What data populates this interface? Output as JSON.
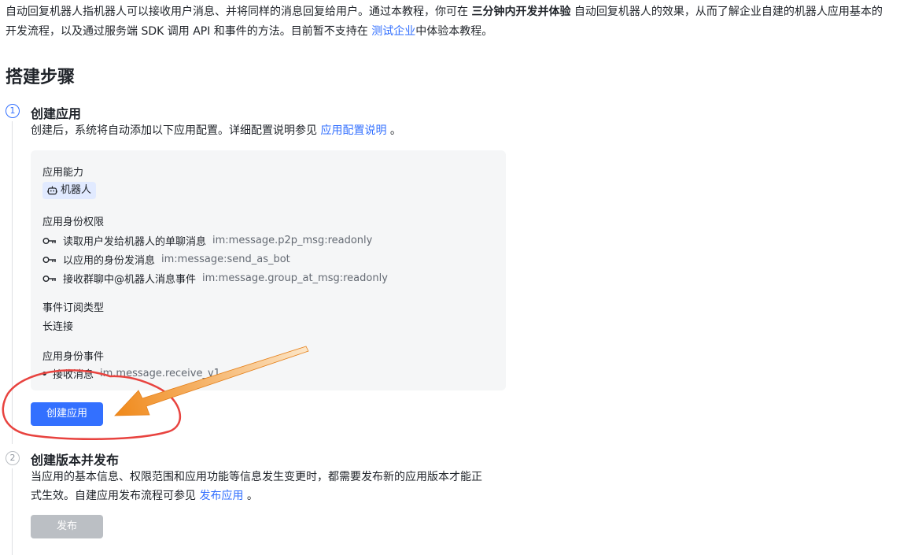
{
  "intro": {
    "text_1": "自动回复机器人指机器人可以接收用户消息、并将同样的消息回复给用户。通过本教程，你可在",
    "bold": "三分钟内开发并体验",
    "text_2": "自动回复机器人的效果，从而了解企业自建的机器人应用基本的开发流程，以及通过服务端 SDK 调用 API 和事件的方法。目前暂不支持在",
    "link": "测试企业",
    "text_3": "中体验本教程。"
  },
  "section_title": "搭建步骤",
  "steps": [
    {
      "num": "1",
      "title": "创建应用",
      "desc": "创建后，系统将自动添加以下应用配置。详细配置说明参见",
      "desc_link": "应用配置说明",
      "desc_tail": "。",
      "config": {
        "ability_label": "应用能力",
        "ability_tag": "机器人",
        "perm_label": "应用身份权限",
        "perms": [
          {
            "name": "读取用户发给机器人的单聊消息",
            "code": "im:message.p2p_msg:readonly"
          },
          {
            "name": "以应用的身份发消息",
            "code": "im:message:send_as_bot"
          },
          {
            "name": "接收群聊中@机器人消息事件",
            "code": "im:message.group_at_msg:readonly"
          }
        ],
        "event_type_label": "事件订阅类型",
        "event_type_value": "长连接",
        "event_label": "应用身份事件",
        "event_name": "接收消息",
        "event_code": "im.message.receive_v1"
      },
      "button": "创建应用"
    },
    {
      "num": "2",
      "title": "创建版本并发布",
      "desc_line1": "当应用的基本信息、权限范围和应用功能等信息发生变更时，都需要发布新的应用版本才能正",
      "desc_line2": "式生效。自建应用发布流程可参见",
      "desc_link": "发布应用",
      "desc_tail": "。",
      "button": "发布"
    }
  ],
  "colors": {
    "accent": "#3370ff",
    "annotation_circle": "#e8433f",
    "annotation_arrow": "#f08a1c"
  }
}
